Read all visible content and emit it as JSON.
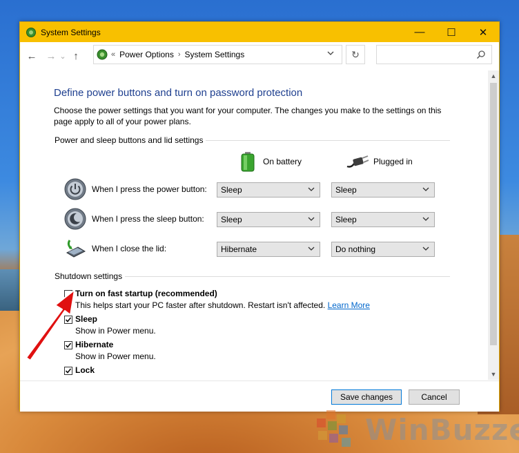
{
  "window": {
    "title": "System Settings",
    "minimize_glyph": "—",
    "maximize_glyph": "☐",
    "close_glyph": "✕"
  },
  "nav": {
    "back_glyph": "←",
    "forward_glyph": "→",
    "recent_glyph": "⌄",
    "up_glyph": "↑",
    "breadcrumb_prefix": "«",
    "breadcrumb": [
      "Power Options",
      "System Settings"
    ],
    "breadcrumb_sep": "›",
    "refresh_glyph": "↻",
    "search_placeholder": ""
  },
  "page": {
    "heading": "Define power buttons and turn on password protection",
    "description": "Choose the power settings that you want for your computer. The changes you make to the settings on this page apply to all of your power plans.",
    "buttons_group_title": "Power and sleep buttons and lid settings",
    "col_battery": "On battery",
    "col_plugged": "Plugged in",
    "rows": [
      {
        "label": "When I press the power button:",
        "battery": "Sleep",
        "plugged": "Sleep"
      },
      {
        "label": "When I press the sleep button:",
        "battery": "Sleep",
        "plugged": "Sleep"
      },
      {
        "label": "When I close the lid:",
        "battery": "Hibernate",
        "plugged": "Do nothing"
      }
    ],
    "shutdown_group_title": "Shutdown settings",
    "shutdown": [
      {
        "label": "Turn on fast startup (recommended)",
        "checked": false,
        "sub": "This helps start your PC faster after shutdown. Restart isn't affected.",
        "link": "Learn More"
      },
      {
        "label": "Sleep",
        "checked": true,
        "sub": "Show in Power menu."
      },
      {
        "label": "Hibernate",
        "checked": true,
        "sub": "Show in Power menu."
      },
      {
        "label": "Lock",
        "checked": true
      }
    ]
  },
  "footer": {
    "save_label": "Save changes",
    "cancel_label": "Cancel"
  },
  "watermark": {
    "text": "WinBuzzer"
  },
  "colors": {
    "titlebar": "#f8c000",
    "heading": "#1e3f8f",
    "link": "#0066cc",
    "arrow": "#e01010"
  }
}
